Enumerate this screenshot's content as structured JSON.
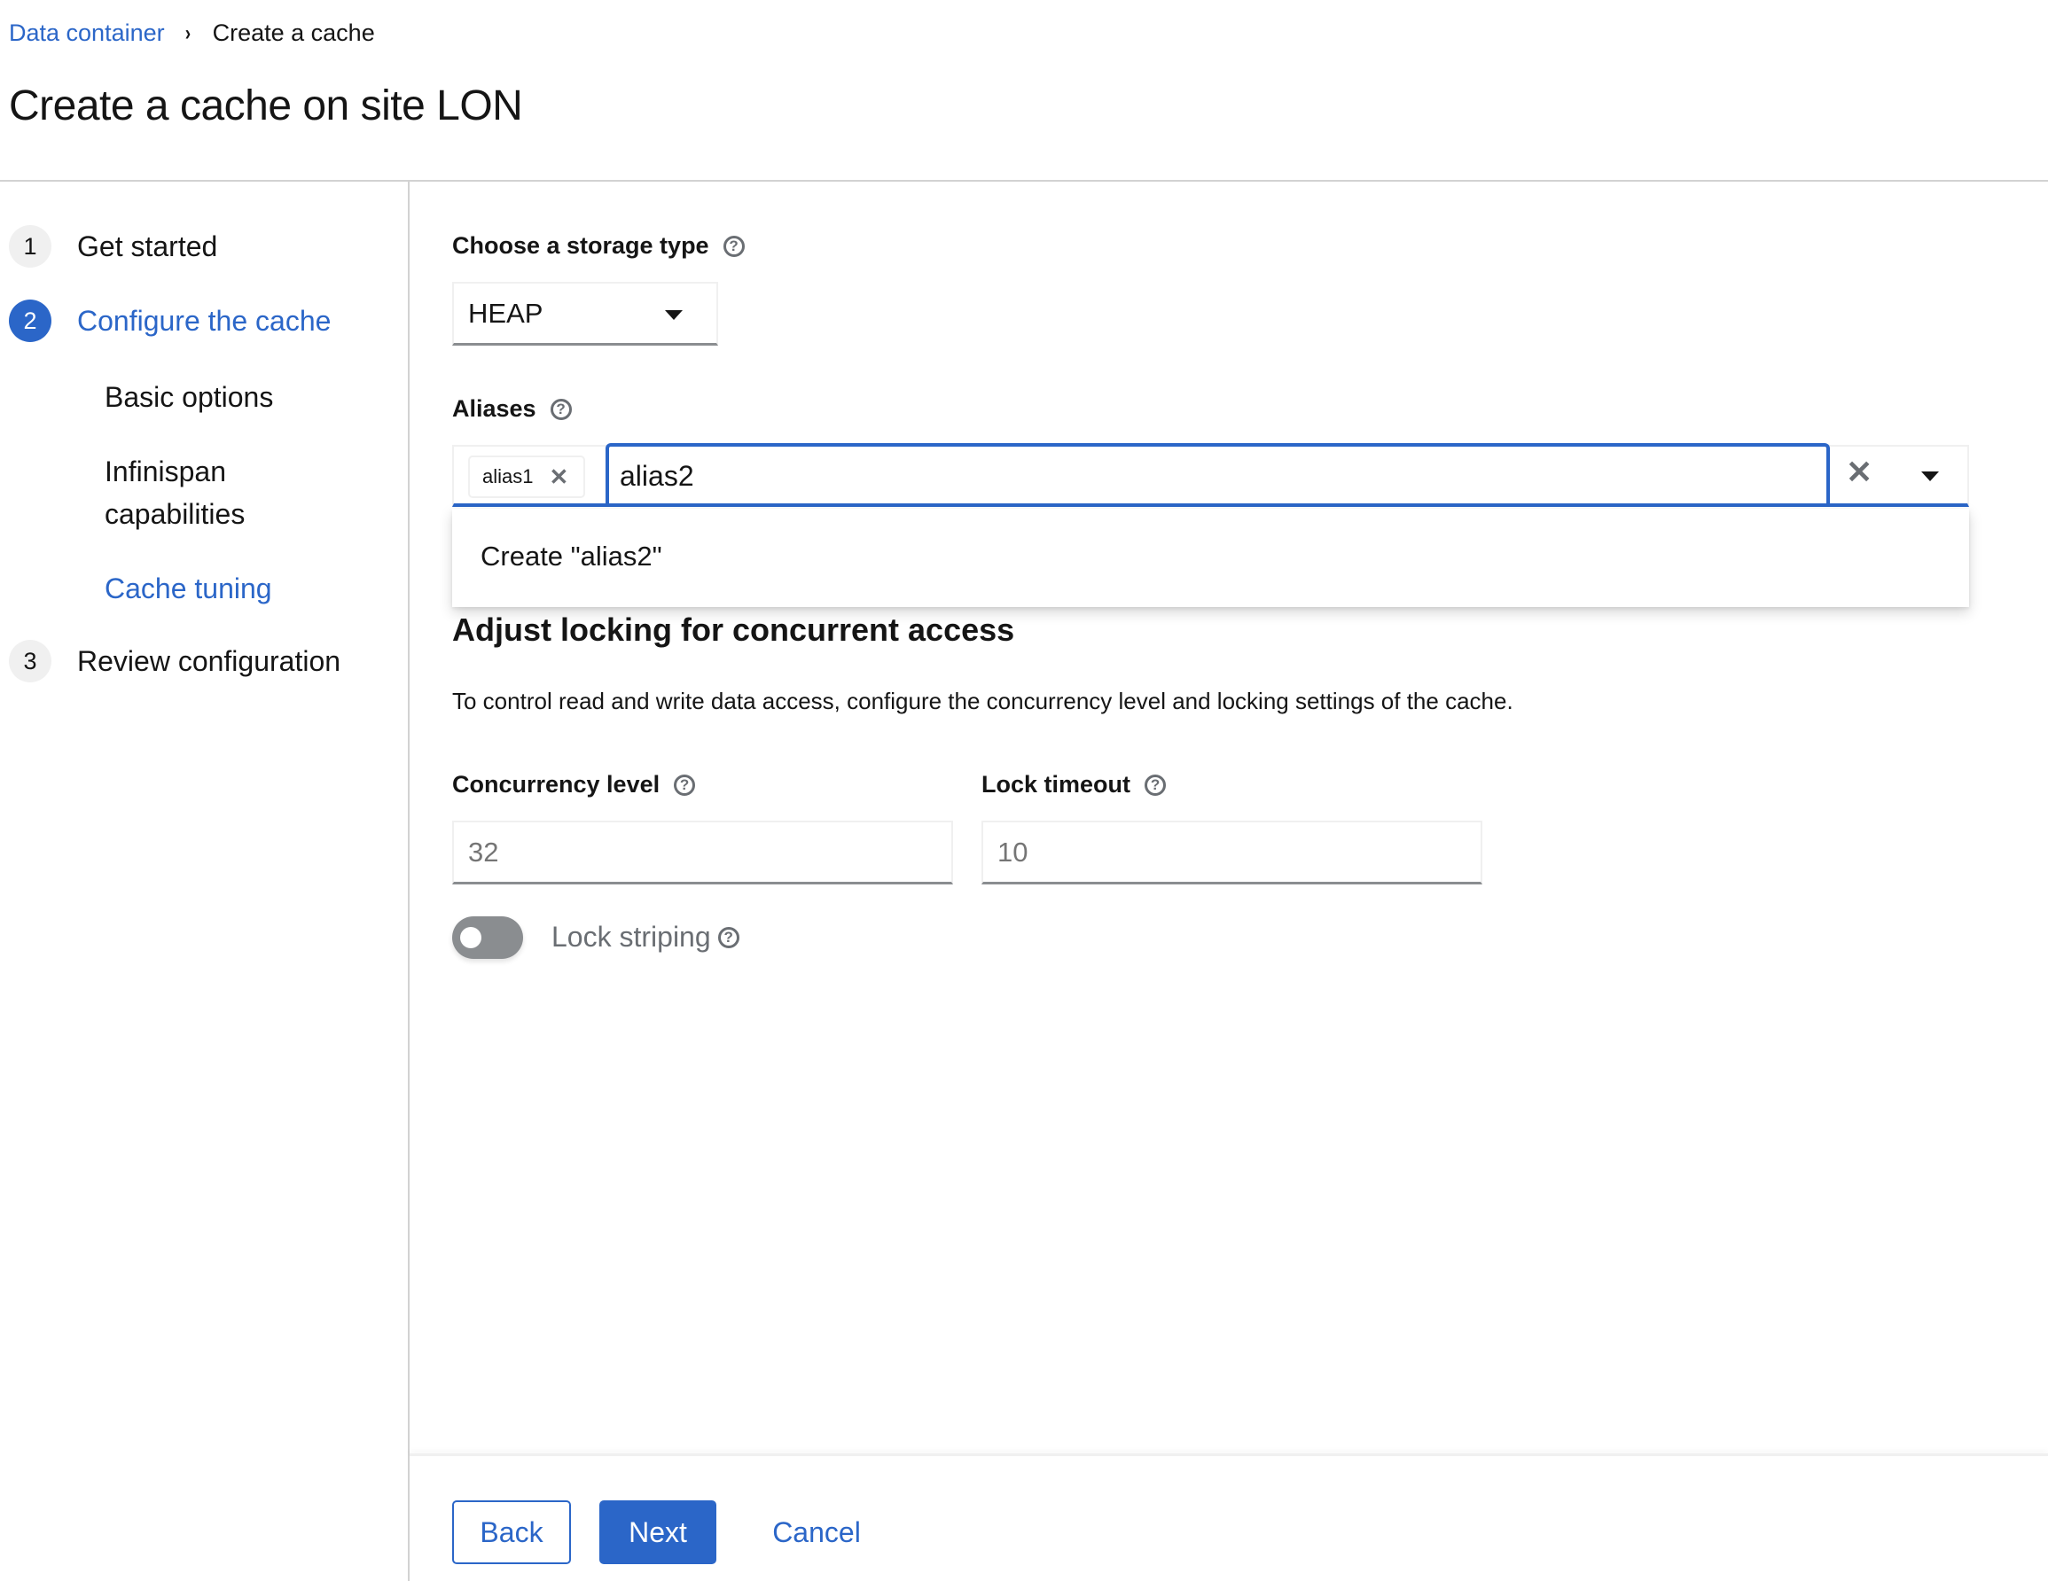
{
  "breadcrumb": {
    "items": [
      "Data container",
      "Create a cache"
    ]
  },
  "page": {
    "title": "Create a cache on site LON"
  },
  "wizard": {
    "steps": [
      {
        "number": "1",
        "label": "Get started"
      },
      {
        "number": "2",
        "label": "Configure the cache",
        "substeps": [
          "Basic options",
          "Infinispan capabilities",
          "Cache tuning"
        ]
      },
      {
        "number": "3",
        "label": "Review configuration"
      }
    ],
    "current_step": "Configure the cache",
    "current_substep": "Cache tuning"
  },
  "form": {
    "storage_type": {
      "label": "Choose a storage type",
      "value": "HEAP"
    },
    "aliases": {
      "label": "Aliases",
      "chips": [
        "alias1"
      ],
      "input_value": "alias2",
      "menu_options": [
        "Create \"alias2\""
      ]
    },
    "locking": {
      "heading": "Adjust locking for concurrent access",
      "description": "To control read and write data access, configure the concurrency level and locking settings of the cache.",
      "concurrency_level": {
        "label": "Concurrency level",
        "placeholder": "32"
      },
      "lock_timeout": {
        "label": "Lock timeout",
        "placeholder": "10"
      },
      "lock_striping": {
        "label": "Lock striping",
        "enabled": false
      }
    }
  },
  "footer": {
    "back_label": "Back",
    "next_label": "Next",
    "cancel_label": "Cancel"
  },
  "icons": {
    "help": "?",
    "breadcrumb_separator": "›",
    "close": "✕"
  },
  "colors": {
    "accent": "#2b66c8",
    "text": "#151515",
    "muted": "#6a6e73",
    "border": "#d2d2d2",
    "toggle_off": "#8a8d90"
  }
}
